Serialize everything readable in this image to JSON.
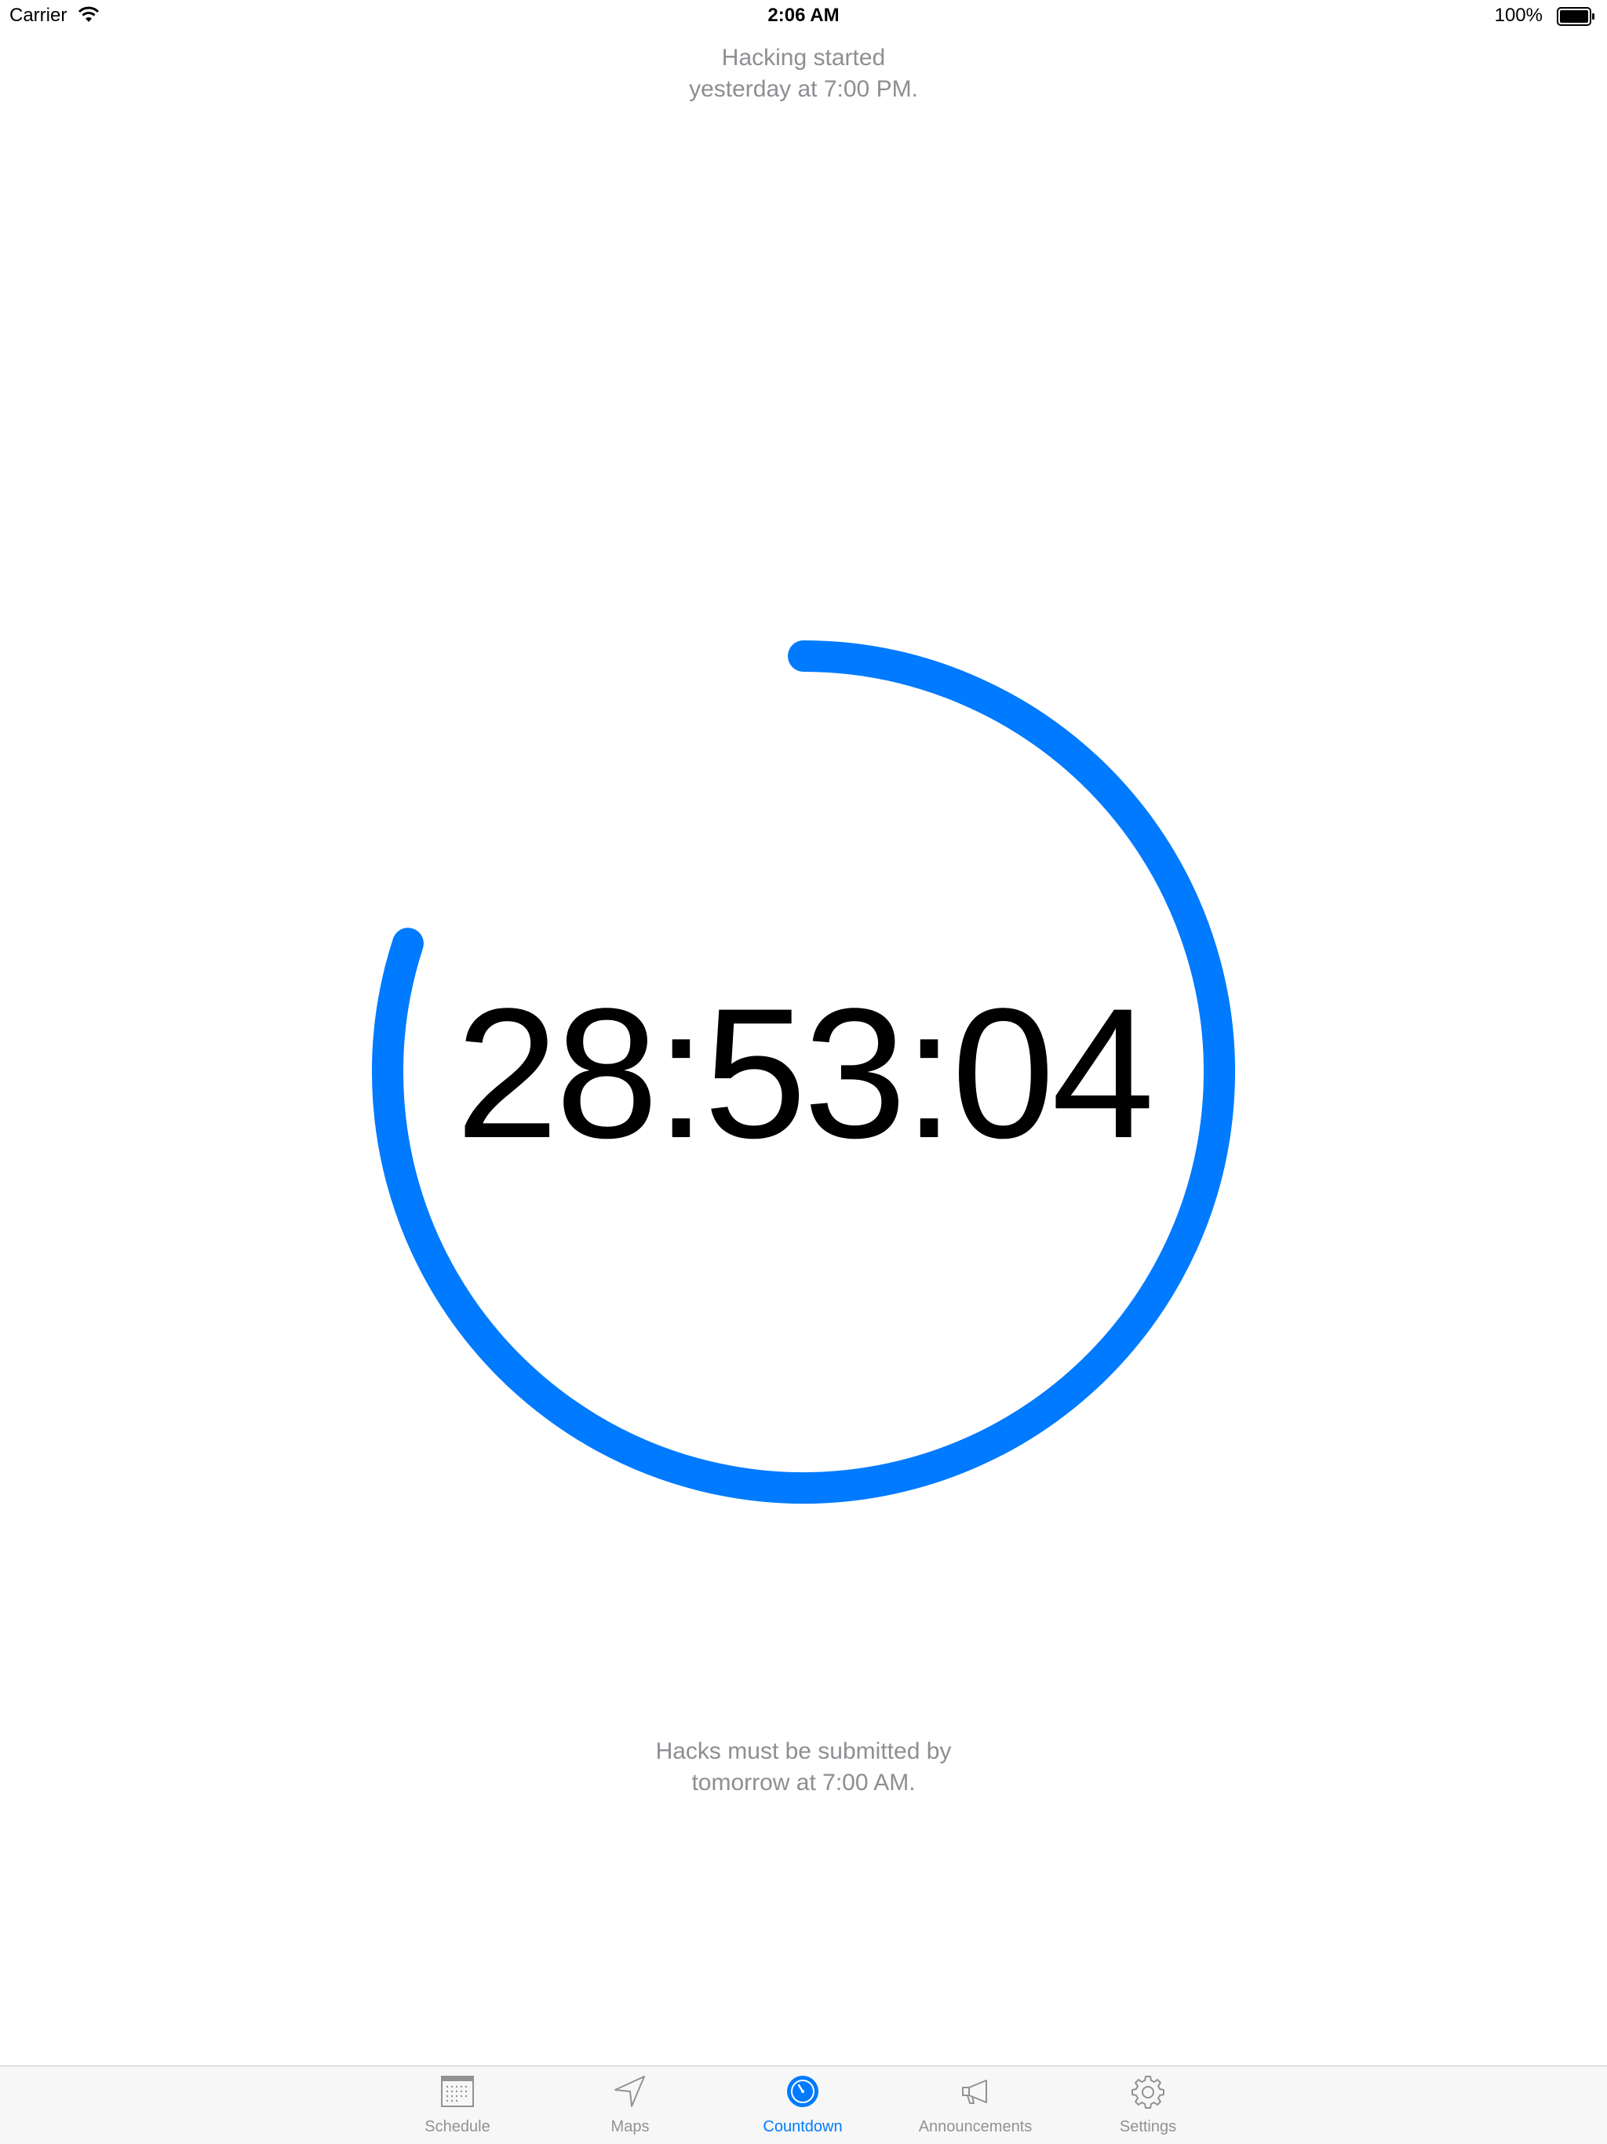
{
  "status_bar": {
    "carrier": "Carrier",
    "wifi_icon": "wifi-icon",
    "time": "2:06 AM",
    "battery_percent": "100%",
    "battery_icon": "battery-icon"
  },
  "hacking_start": {
    "line1": "Hacking started",
    "line2": "yesterday at 7:00 PM."
  },
  "countdown": {
    "time_remaining": "28:53:04",
    "progress_fraction": 0.8,
    "ring_color": "#007aff"
  },
  "submission_deadline": {
    "line1": "Hacks must be submitted by",
    "line2": "tomorrow at 7:00 AM."
  },
  "tab_bar": {
    "active_color": "#007aff",
    "inactive_color": "#929292",
    "tabs": [
      {
        "label": "Schedule",
        "icon": "calendar-icon",
        "active": false
      },
      {
        "label": "Maps",
        "icon": "location-arrow-icon",
        "active": false
      },
      {
        "label": "Countdown",
        "icon": "timer-icon",
        "active": true
      },
      {
        "label": "Announcements",
        "icon": "megaphone-icon",
        "active": false
      },
      {
        "label": "Settings",
        "icon": "gear-icon",
        "active": false
      }
    ]
  }
}
